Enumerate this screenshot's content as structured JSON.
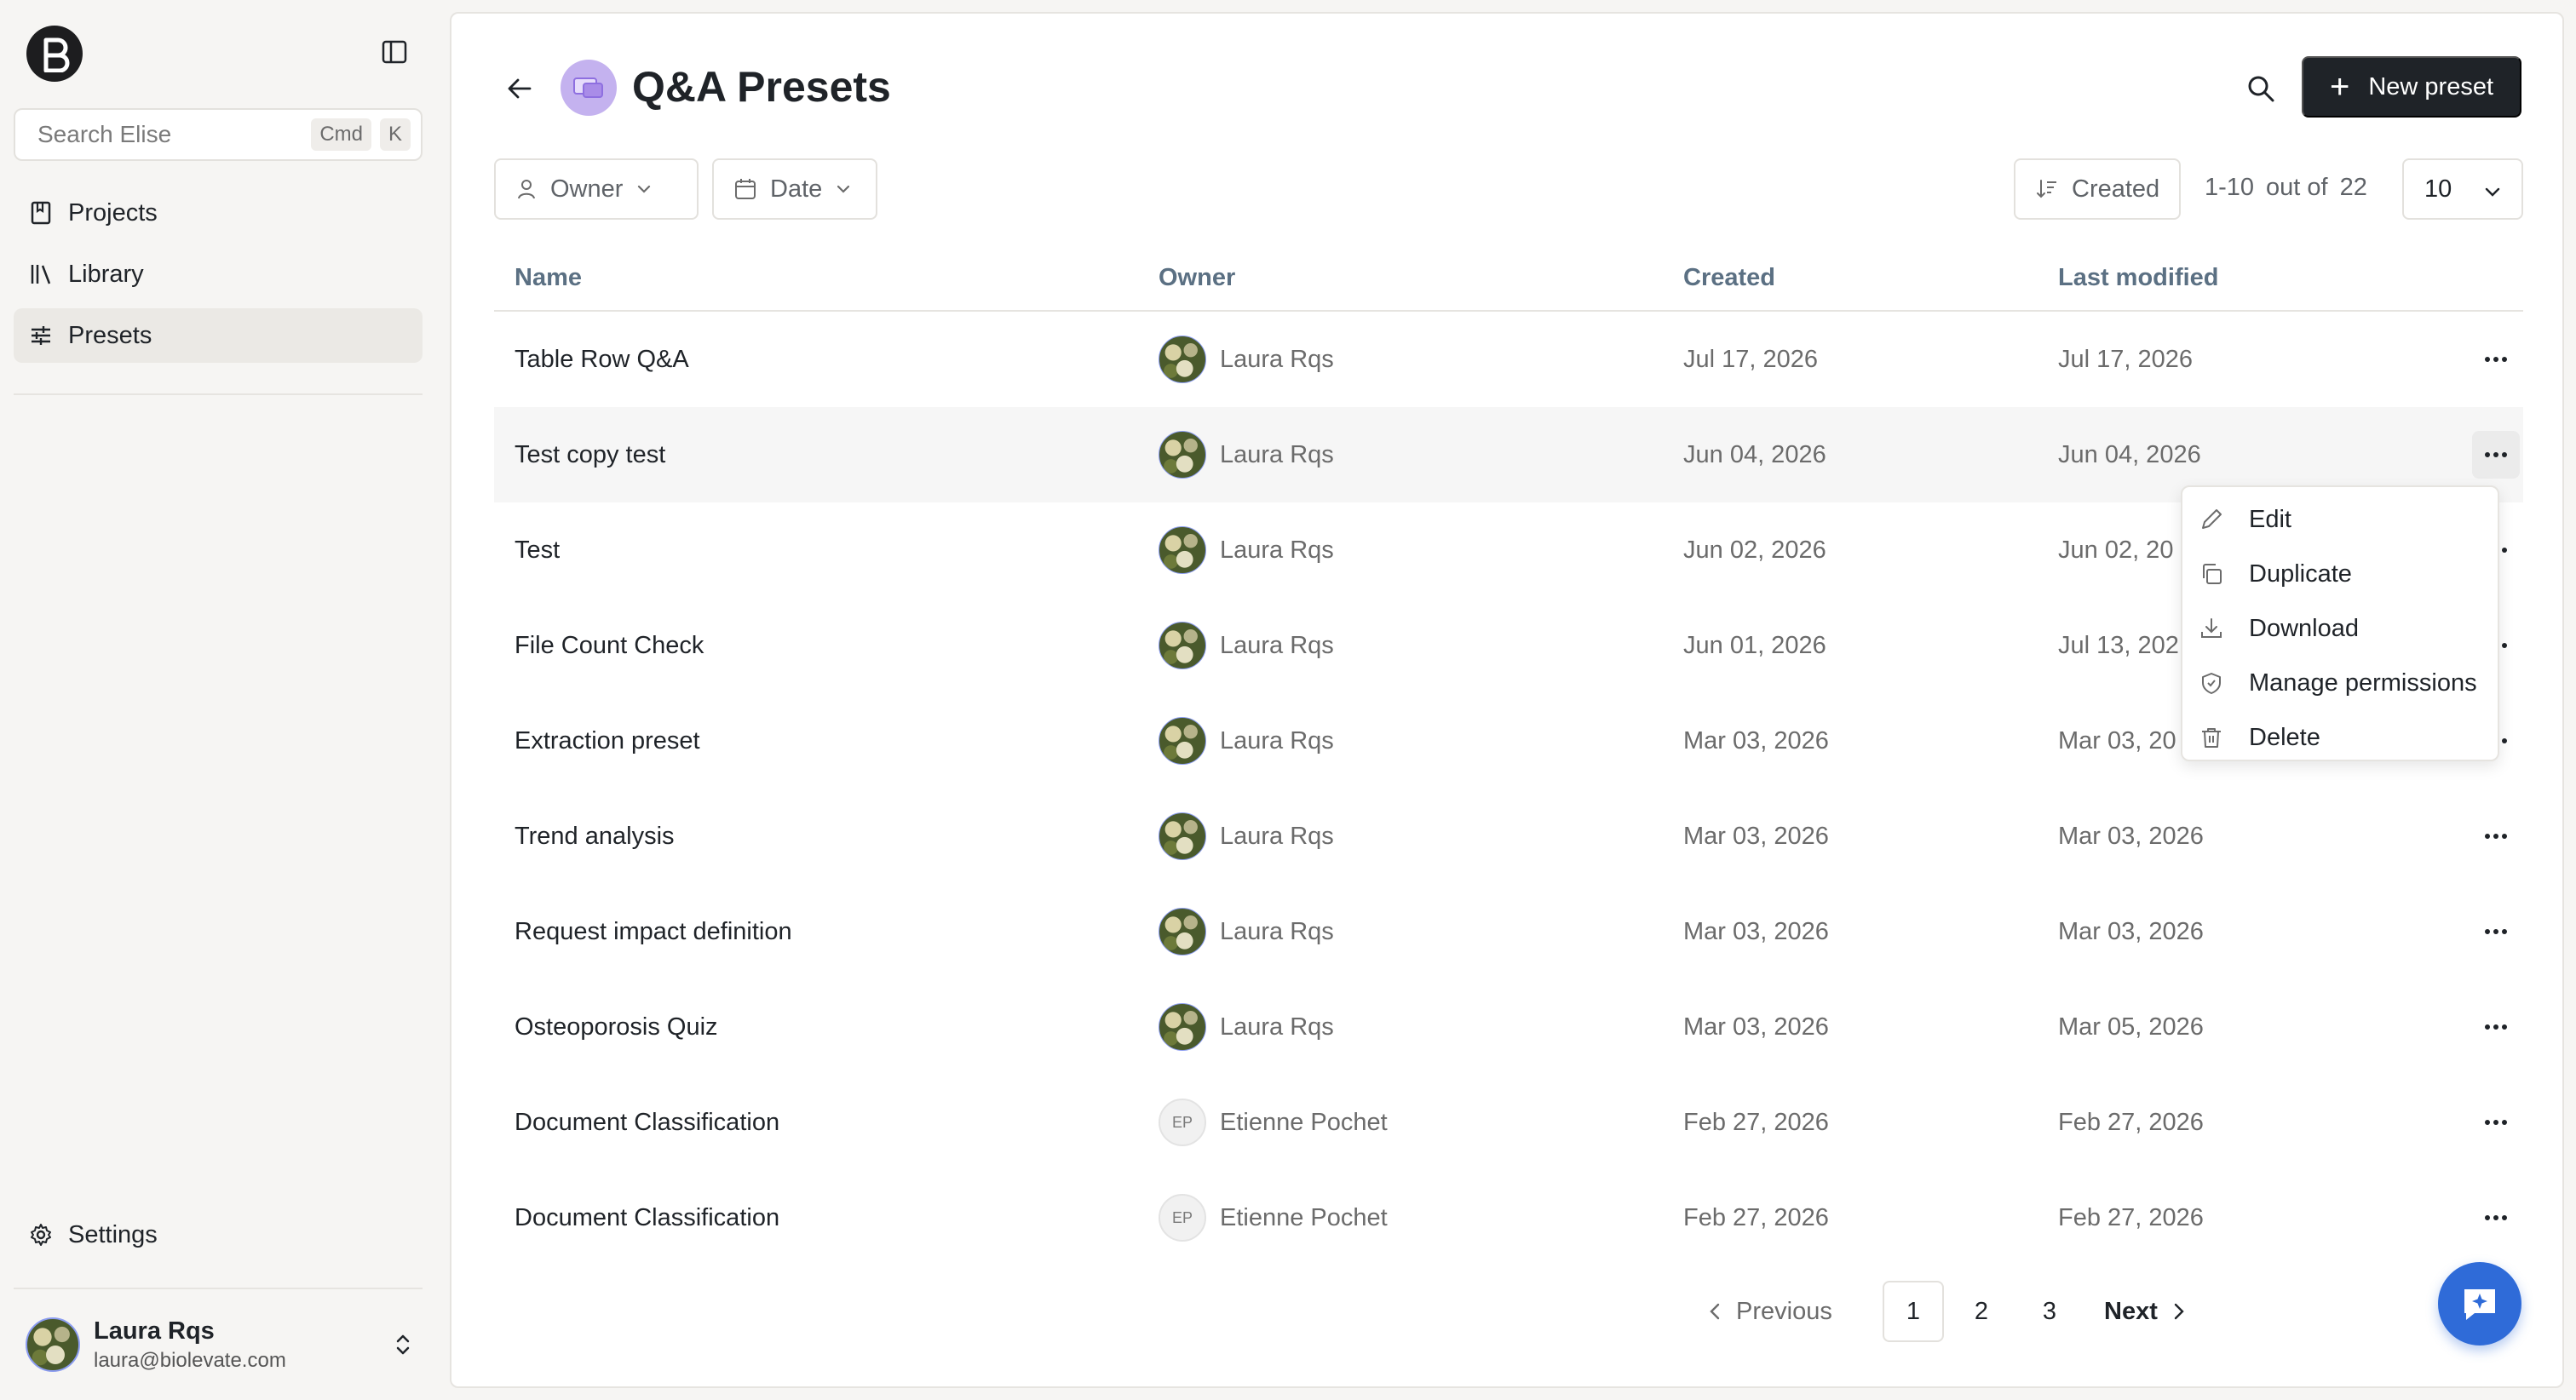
{
  "sidebar": {
    "search_placeholder": "Search Elise",
    "shortcut_cmd": "Cmd",
    "shortcut_key": "K",
    "items": [
      {
        "label": "Projects",
        "icon": "book-icon"
      },
      {
        "label": "Library",
        "icon": "library-icon"
      },
      {
        "label": "Presets",
        "icon": "sliders-icon",
        "active": true
      }
    ],
    "settings_label": "Settings",
    "user": {
      "name": "Laura Rqs",
      "email": "laura@biolevate.com"
    }
  },
  "header": {
    "title": "Q&A Presets",
    "new_button": "New preset"
  },
  "filters": {
    "owner": "Owner",
    "date": "Date",
    "sort": "Created",
    "range": "1-10",
    "out_of": "out of",
    "total": "22",
    "page_size": "10"
  },
  "table": {
    "columns": [
      "Name",
      "Owner",
      "Created",
      "Last modified"
    ],
    "rows": [
      {
        "name": "Table Row Q&A",
        "owner": "Laura Rqs",
        "owner_initials": "",
        "created": "Jul 17, 2026",
        "modified": "Jul 17, 2026"
      },
      {
        "name": "Test copy test",
        "owner": "Laura Rqs",
        "owner_initials": "",
        "created": "Jun 04, 2026",
        "modified": "Jun 04, 2026"
      },
      {
        "name": "Test",
        "owner": "Laura Rqs",
        "owner_initials": "",
        "created": "Jun 02, 2026",
        "modified": "Jun 02, 20"
      },
      {
        "name": "File Count Check",
        "owner": "Laura Rqs",
        "owner_initials": "",
        "created": "Jun 01, 2026",
        "modified": "Jul 13, 202"
      },
      {
        "name": "Extraction preset",
        "owner": "Laura Rqs",
        "owner_initials": "",
        "created": "Mar 03, 2026",
        "modified": "Mar 03, 20"
      },
      {
        "name": "Trend analysis",
        "owner": "Laura Rqs",
        "owner_initials": "",
        "created": "Mar 03, 2026",
        "modified": "Mar 03, 2026"
      },
      {
        "name": "Request impact definition",
        "owner": "Laura Rqs",
        "owner_initials": "",
        "created": "Mar 03, 2026",
        "modified": "Mar 03, 2026"
      },
      {
        "name": "Osteoporosis Quiz",
        "owner": "Laura Rqs",
        "owner_initials": "",
        "created": "Mar 03, 2026",
        "modified": "Mar 05, 2026"
      },
      {
        "name": "Document Classification",
        "owner": "Etienne Pochet",
        "owner_initials": "EP",
        "created": "Feb 27, 2026",
        "modified": "Feb 27, 2026"
      },
      {
        "name": "Document Classification",
        "owner": "Etienne Pochet",
        "owner_initials": "EP",
        "created": "Feb 27, 2026",
        "modified": "Feb 27, 2026"
      }
    ]
  },
  "context_menu": {
    "items": [
      {
        "label": "Edit",
        "icon": "pencil-icon"
      },
      {
        "label": "Duplicate",
        "icon": "copy-icon"
      },
      {
        "label": "Download",
        "icon": "download-icon"
      },
      {
        "label": "Manage permissions",
        "icon": "shield-icon"
      },
      {
        "label": "Delete",
        "icon": "trash-icon"
      }
    ]
  },
  "pagination": {
    "previous": "Previous",
    "pages": [
      "1",
      "2",
      "3"
    ],
    "current": "1",
    "next": "Next"
  },
  "colors": {
    "primary_button": "#1f2328",
    "title_icon": "#c4b2ef",
    "chat_fab": "#2f6bd8"
  }
}
